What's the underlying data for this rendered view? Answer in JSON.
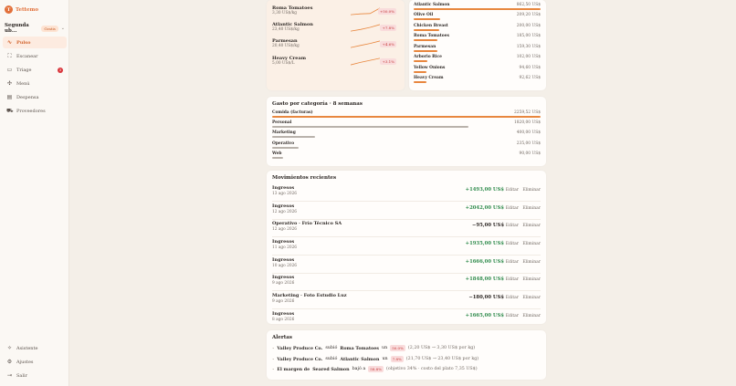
{
  "brand": {
    "name": "Tettemo",
    "logo_char": "T"
  },
  "venue": {
    "name": "Segunda ub...",
    "badge": "Gratis"
  },
  "nav": {
    "items": [
      {
        "label": "Pulso",
        "icon": "∿",
        "active": true
      },
      {
        "label": "Escanear",
        "icon": "⛶"
      },
      {
        "label": "Triage",
        "icon": "▭",
        "badge": "3"
      },
      {
        "label": "Menú",
        "icon": "✣"
      },
      {
        "label": "Despensa",
        "icon": "▤"
      },
      {
        "label": "Proveedores",
        "icon": "⛟"
      }
    ],
    "bottom": [
      {
        "label": "Asistente",
        "icon": "✧"
      },
      {
        "label": "Ajustes",
        "icon": "⚙"
      },
      {
        "label": "Salir",
        "icon": "⇥"
      }
    ]
  },
  "price_changes": [
    {
      "name": "Roma Tomatoes",
      "price": "3,30 US$/kg",
      "pct": "+50.0%",
      "spark": [
        0.1,
        0.2,
        0.25,
        0.9
      ]
    },
    {
      "name": "Atlantic Salmon",
      "price": "23,40 US$/kg",
      "pct": "+7.8%",
      "spark": [
        0.1,
        0.3,
        0.55,
        0.9
      ]
    },
    {
      "name": "Parmesan",
      "price": "20,40 US$/kg",
      "pct": "+4.6%",
      "spark": [
        0.1,
        0.35,
        0.6,
        0.9
      ]
    },
    {
      "name": "Heavy Cream",
      "price": "5,00 US$/L",
      "pct": "+3.1%",
      "spark": [
        0.1,
        0.4,
        0.65,
        0.9
      ]
    }
  ],
  "top_ingredients": [
    {
      "name": "Atlantic Salmon",
      "value": "862,50 US$",
      "pct": 100
    },
    {
      "name": "Olive Oil",
      "value": "209,20 US$",
      "pct": 21
    },
    {
      "name": "Chicken Breast",
      "value": "200,00 US$",
      "pct": 20
    },
    {
      "name": "Roma Tomatoes",
      "value": "185,00 US$",
      "pct": 19
    },
    {
      "name": "Parmesan",
      "value": "159,30 US$",
      "pct": 19
    },
    {
      "name": "Arborio Rice",
      "value": "102,00 US$",
      "pct": 11
    },
    {
      "name": "Yellow Onions",
      "value": "94,60 US$",
      "pct": 10
    },
    {
      "name": "Heavy Cream",
      "value": "92,62 US$",
      "pct": 10
    }
  ],
  "category_spend": {
    "title": "Gasto por categoría · 8 semanas",
    "rows": [
      {
        "name": "Comida (facturas)",
        "value": "2259,52 US$",
        "pct": 100,
        "color": "#e8873f"
      },
      {
        "name": "Personal",
        "value": "1820,00 US$",
        "pct": 73,
        "color": "#b9b2ab"
      },
      {
        "name": "Marketing",
        "value": "400,00 US$",
        "pct": 16,
        "color": "#b9b2ab"
      },
      {
        "name": "Operativo",
        "value": "235,00 US$",
        "pct": 10,
        "color": "#b9b2ab"
      },
      {
        "name": "Web",
        "value": "90,00 US$",
        "pct": 4,
        "color": "#b9b2ab"
      }
    ]
  },
  "movements": {
    "title": "Movimientos recientes",
    "edit_label": "Editar",
    "delete_label": "Eliminar",
    "rows": [
      {
        "name": "Ingresos",
        "date": "13 ago 2026",
        "amount": "+1493,00 US$",
        "type": "pos"
      },
      {
        "name": "Ingresos",
        "date": "12 ago 2026",
        "amount": "+2042,00 US$",
        "type": "pos"
      },
      {
        "name": "Operativo · Frío Técnico SA",
        "date": "12 ago 2026",
        "amount": "−95,00 US$",
        "type": "neg"
      },
      {
        "name": "Ingresos",
        "date": "11 ago 2026",
        "amount": "+1935,00 US$",
        "type": "pos"
      },
      {
        "name": "Ingresos",
        "date": "10 ago 2026",
        "amount": "+1666,00 US$",
        "type": "pos"
      },
      {
        "name": "Ingresos",
        "date": "9 ago 2026",
        "amount": "+1848,00 US$",
        "type": "pos"
      },
      {
        "name": "Marketing · Foto Estudio Luz",
        "date": "9 ago 2026",
        "amount": "−180,00 US$",
        "type": "neg"
      },
      {
        "name": "Ingresos",
        "date": "8 ago 2026",
        "amount": "+1665,00 US$",
        "type": "pos"
      }
    ]
  },
  "alerts": {
    "title": "Alertas",
    "items": [
      {
        "p1": "Valley Produce Co.",
        "t1": "subió",
        "p2": "Roma Tomatoes",
        "t2": "un",
        "chip": "50.0%",
        "muted": "(2,20 US$ → 3,30 US$ por kg)"
      },
      {
        "p1": "Valley Produce Co.",
        "t1": "subió",
        "p2": "Atlantic Salmon",
        "t2": "un",
        "chip": "7.8%",
        "muted": "(21,70 US$ → 23,40 US$ por kg)"
      },
      {
        "p1": "El margen de",
        "t1": "",
        "p2": "Seared Salmon",
        "t2": "bajó a",
        "chip": "58.8%",
        "muted": "(objetivo 34% · costo del plato 7,35 US$)"
      }
    ]
  }
}
